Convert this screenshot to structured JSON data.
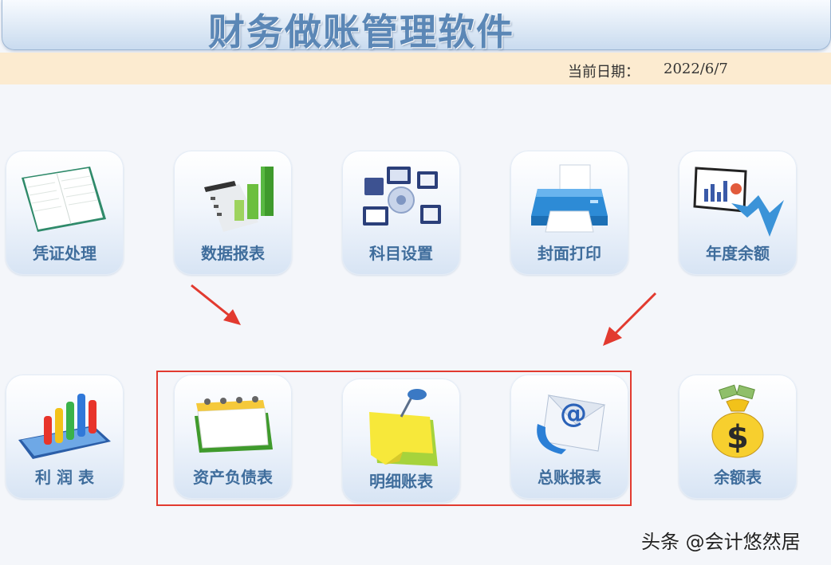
{
  "header": {
    "title": "财务做账管理软件"
  },
  "date_bar": {
    "label": "当前日期：",
    "value": "2022/6/7"
  },
  "modules": [
    {
      "label": "凭证处理",
      "icon": "ledger-book-icon"
    },
    {
      "label": "数据报表",
      "icon": "bar-chart-icon"
    },
    {
      "label": "科目设置",
      "icon": "network-screens-icon"
    },
    {
      "label": "封面打印",
      "icon": "printer-icon"
    },
    {
      "label": "年度余额",
      "icon": "presentation-chart-icon"
    },
    {
      "label": "利 润 表",
      "icon": "3d-bar-chart-icon"
    },
    {
      "label": "资产负债表",
      "icon": "calendar-icon"
    },
    {
      "label": "明细账表",
      "icon": "sticky-note-pin-icon"
    },
    {
      "label": "总账报表",
      "icon": "email-at-icon"
    },
    {
      "label": "余额表",
      "icon": "money-bag-icon"
    }
  ],
  "watermark": {
    "text": "头条 @会计悠然居"
  },
  "colors": {
    "accent": "#3f6d9c",
    "title": "#5b87b6",
    "highlight": "#e23a2f",
    "date_bar": "#fcebd0"
  }
}
